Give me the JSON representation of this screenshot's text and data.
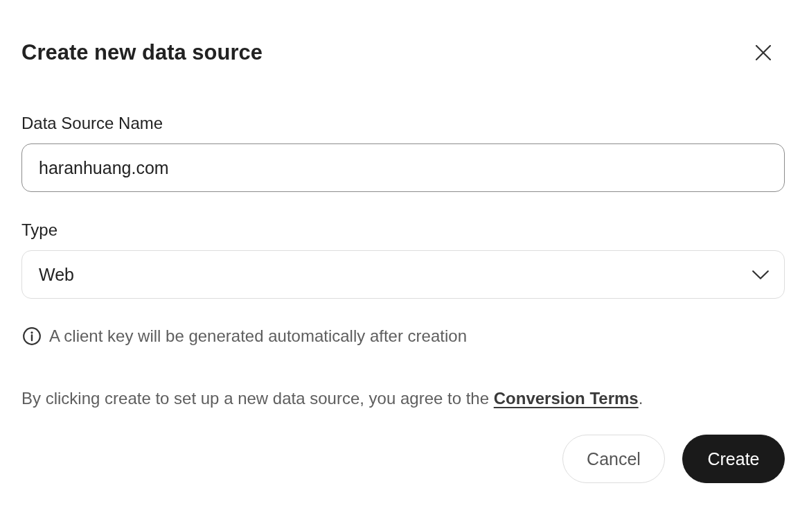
{
  "dialog": {
    "title": "Create new data source"
  },
  "fields": [
    {
      "kind": "text",
      "label": "Data Source Name",
      "value": "haranhuang.com",
      "focused": true
    },
    {
      "kind": "select",
      "label": "Type",
      "value": "Web",
      "focused": false
    }
  ],
  "info_note": "A client key will be generated automatically after creation",
  "consent": {
    "text": "By clicking create to set up a new data source, you agree to the ",
    "link": "Conversion Terms",
    "text_after": "."
  },
  "buttons": [
    {
      "kind": "secondary",
      "label": "Cancel"
    },
    {
      "kind": "primary",
      "label": "Create"
    }
  ]
}
